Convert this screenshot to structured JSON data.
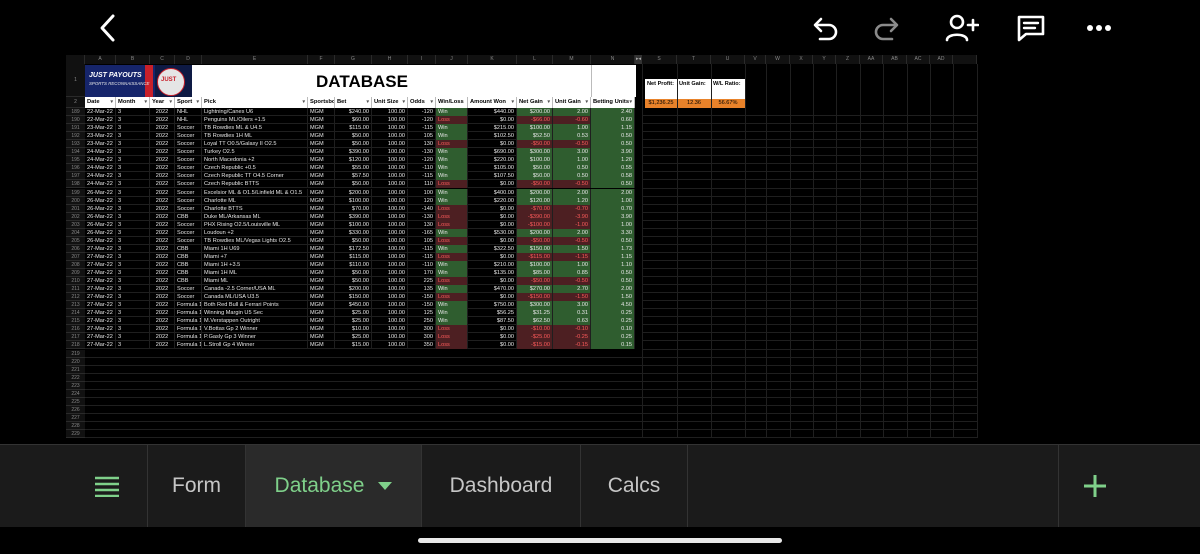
{
  "toolbar": {
    "icons": [
      "back-icon",
      "undo-icon",
      "redo-icon",
      "share-person-icon",
      "comment-icon",
      "more-icon"
    ]
  },
  "sheet": {
    "columns": [
      "A",
      "B",
      "C",
      "D",
      "E",
      "F",
      "G",
      "H",
      "I",
      "J",
      "K",
      "L",
      "M",
      "N",
      "S",
      "T",
      "U",
      "V",
      "W",
      "X",
      "Y",
      "Z",
      "AA",
      "AB",
      "AC",
      "AD"
    ],
    "title": "DATABASE",
    "logo_text_1": "JUST PAYOUTS",
    "logo_text_2": "SPORTS RECONNAISSANCE",
    "logo_badge": "JUST",
    "headers": [
      "Date",
      "Month",
      "Year",
      "Sport",
      "Pick",
      "Sportsbook",
      "Bet",
      "Unit Size",
      "Odds",
      "Win/Loss",
      "Amount Won",
      "Net Gain",
      "Unit Gain",
      "Betting Units"
    ],
    "summary": {
      "net_profit_label": "Net Profit:",
      "unit_gain_label": "Unit Gain:",
      "wl_ratio_label": "W/L Ratio:",
      "net_profit": "$1,236.25",
      "unit_gain": "12.36",
      "wl_ratio": "56.67%"
    },
    "row_numbers": [
      "1",
      "2",
      "189",
      "190",
      "191",
      "192",
      "193",
      "194",
      "195",
      "196",
      "197",
      "198",
      "199",
      "200",
      "201",
      "202",
      "203",
      "204",
      "205",
      "206",
      "207",
      "208",
      "209",
      "210",
      "211",
      "212",
      "213",
      "214",
      "215",
      "216",
      "217",
      "218",
      "219",
      "220",
      "221",
      "222",
      "223",
      "224",
      "225",
      "226",
      "227",
      "228",
      "229"
    ],
    "rows": [
      [
        "22-Mar-22",
        "3",
        "2022",
        "NHL",
        "Lightning/Canes U6",
        "MGM",
        "$240.00",
        "100.00",
        "-120",
        "Win",
        "$440.00",
        "$200.00",
        "2.00",
        "2.40"
      ],
      [
        "22-Mar-22",
        "3",
        "2022",
        "NHL",
        "Penguins ML/Oilers +1.5",
        "MGM",
        "$60.00",
        "100.00",
        "-120",
        "Loss",
        "$0.00",
        "-$66.00",
        "-0.60",
        "0.60"
      ],
      [
        "23-Mar-22",
        "3",
        "2022",
        "Soccer",
        "TB Rowdies ML & U4.5",
        "MGM",
        "$115.00",
        "100.00",
        "-115",
        "Win",
        "$215.00",
        "$100.00",
        "1.00",
        "1.15"
      ],
      [
        "23-Mar-22",
        "3",
        "2022",
        "Soccer",
        "TB Rowdies 1H ML",
        "MGM",
        "$50.00",
        "100.00",
        "105",
        "Win",
        "$102.50",
        "$52.50",
        "0.53",
        "0.50"
      ],
      [
        "23-Mar-22",
        "3",
        "2022",
        "Soccer",
        "Loyal TT O0.5/Galaxy II O2.5",
        "MGM",
        "$50.00",
        "100.00",
        "130",
        "Loss",
        "$0.00",
        "-$50.00",
        "-0.50",
        "0.50"
      ],
      [
        "24-Mar-22",
        "3",
        "2022",
        "Soccer",
        "Turkey O2.5",
        "MGM",
        "$390.00",
        "100.00",
        "-130",
        "Win",
        "$690.00",
        "$300.00",
        "3.00",
        "3.90"
      ],
      [
        "24-Mar-22",
        "3",
        "2022",
        "Soccer",
        "North Macedonia +2",
        "MGM",
        "$120.00",
        "100.00",
        "-120",
        "Win",
        "$220.00",
        "$100.00",
        "1.00",
        "1.20"
      ],
      [
        "24-Mar-22",
        "3",
        "2022",
        "Soccer",
        "Czech Republic +0.5",
        "MGM",
        "$55.00",
        "100.00",
        "-110",
        "Win",
        "$105.00",
        "$50.00",
        "0.50",
        "0.55"
      ],
      [
        "24-Mar-22",
        "3",
        "2022",
        "Soccer",
        "Czech Republic TT O4.5 Corner",
        "MGM",
        "$57.50",
        "100.00",
        "-115",
        "Win",
        "$107.50",
        "$50.00",
        "0.50",
        "0.58"
      ],
      [
        "24-Mar-22",
        "3",
        "2022",
        "Soccer",
        "Czech Republic BTTS",
        "MGM",
        "$50.00",
        "100.00",
        "110",
        "Loss",
        "$0.00",
        "-$50.00",
        "-0.50",
        "0.50"
      ],
      [
        "26-Mar-22",
        "3",
        "2022",
        "Soccer",
        "Excelsior ML & O1.5/Linfield ML & O1.5",
        "MGM",
        "$200.00",
        "100.00",
        "100",
        "Win",
        "$400.00",
        "$200.00",
        "2.00",
        "2.00"
      ],
      [
        "26-Mar-22",
        "3",
        "2022",
        "Soccer",
        "Charlotte ML",
        "MGM",
        "$100.00",
        "100.00",
        "120",
        "Win",
        "$220.00",
        "$120.00",
        "1.20",
        "1.00"
      ],
      [
        "26-Mar-22",
        "3",
        "2022",
        "Soccer",
        "Charlotte BTTS",
        "MGM",
        "$70.00",
        "100.00",
        "-140",
        "Loss",
        "$0.00",
        "-$70.00",
        "-0.70",
        "0.70"
      ],
      [
        "26-Mar-22",
        "3",
        "2022",
        "CBB",
        "Duke ML/Arkansas ML",
        "MGM",
        "$390.00",
        "100.00",
        "-130",
        "Loss",
        "$0.00",
        "-$390.00",
        "-3.90",
        "3.90"
      ],
      [
        "26-Mar-22",
        "3",
        "2022",
        "Soccer",
        "PHX Rising O2.5/Louisville ML",
        "MGM",
        "$100.00",
        "100.00",
        "130",
        "Loss",
        "$0.00",
        "-$100.00",
        "-1.00",
        "1.00"
      ],
      [
        "26-Mar-22",
        "3",
        "2022",
        "Soccer",
        "Loudoun +2",
        "MGM",
        "$330.00",
        "100.00",
        "-165",
        "Win",
        "$530.00",
        "$200.00",
        "2.00",
        "3.30"
      ],
      [
        "26-Mar-22",
        "3",
        "2022",
        "Soccer",
        "TB Rowdies ML/Vegas Lights O2.5",
        "MGM",
        "$50.00",
        "100.00",
        "105",
        "Loss",
        "$0.00",
        "-$50.00",
        "-0.50",
        "0.50"
      ],
      [
        "27-Mar-22",
        "3",
        "2022",
        "CBB",
        "Miami 1H U69",
        "MGM",
        "$172.50",
        "100.00",
        "-115",
        "Win",
        "$322.50",
        "$150.00",
        "1.50",
        "1.73"
      ],
      [
        "27-Mar-22",
        "3",
        "2022",
        "CBB",
        "Miami +7",
        "MGM",
        "$115.00",
        "100.00",
        "-115",
        "Loss",
        "$0.00",
        "-$115.00",
        "-1.15",
        "1.15"
      ],
      [
        "27-Mar-22",
        "3",
        "2022",
        "CBB",
        "Miami 1H +3.5",
        "MGM",
        "$110.00",
        "100.00",
        "-110",
        "Win",
        "$210.00",
        "$100.00",
        "1.00",
        "1.10"
      ],
      [
        "27-Mar-22",
        "3",
        "2022",
        "CBB",
        "Miami 1H ML",
        "MGM",
        "$50.00",
        "100.00",
        "170",
        "Win",
        "$135.00",
        "$85.00",
        "0.85",
        "0.50"
      ],
      [
        "27-Mar-22",
        "3",
        "2022",
        "CBB",
        "Miami ML",
        "MGM",
        "$50.00",
        "100.00",
        "225",
        "Loss",
        "$0.00",
        "-$50.00",
        "-0.50",
        "0.50"
      ],
      [
        "27-Mar-22",
        "3",
        "2022",
        "Soccer",
        "Canada -2.5 Corner/USA ML",
        "MGM",
        "$200.00",
        "100.00",
        "135",
        "Win",
        "$470.00",
        "$270.00",
        "2.70",
        "2.00"
      ],
      [
        "27-Mar-22",
        "3",
        "2022",
        "Soccer",
        "Canada ML/USA U3.5",
        "MGM",
        "$150.00",
        "100.00",
        "-150",
        "Loss",
        "$0.00",
        "-$150.00",
        "-1.50",
        "1.50"
      ],
      [
        "27-Mar-22",
        "3",
        "2022",
        "Formula 1",
        "Both Red Bull & Ferrari Points",
        "MGM",
        "$450.00",
        "100.00",
        "-150",
        "Win",
        "$750.00",
        "$300.00",
        "3.00",
        "4.50"
      ],
      [
        "27-Mar-22",
        "3",
        "2022",
        "Formula 1",
        "Winning Margin U5 Sec",
        "MGM",
        "$25.00",
        "100.00",
        "125",
        "Win",
        "$56.25",
        "$31.25",
        "0.31",
        "0.25"
      ],
      [
        "27-Mar-22",
        "3",
        "2022",
        "Formula 1",
        "M.Verstappen Outright",
        "MGM",
        "$25.00",
        "100.00",
        "250",
        "Win",
        "$87.50",
        "$62.50",
        "0.63",
        "0.25"
      ],
      [
        "27-Mar-22",
        "3",
        "2022",
        "Formula 1",
        "V.Bottas Gp 2 Winner",
        "MGM",
        "$10.00",
        "100.00",
        "300",
        "Loss",
        "$0.00",
        "-$10.00",
        "-0.10",
        "0.10"
      ],
      [
        "27-Mar-22",
        "3",
        "2022",
        "Formula 1",
        "P.Gasly Gp 3 Winner",
        "MGM",
        "$25.00",
        "100.00",
        "300",
        "Loss",
        "$0.00",
        "-$25.00",
        "-0.25",
        "0.25"
      ],
      [
        "27-Mar-22",
        "3",
        "2022",
        "Formula 1",
        "L.Stroll Gp 4 Winner",
        "MGM",
        "$15.00",
        "100.00",
        "350",
        "Loss",
        "$0.00",
        "-$15.00",
        "-0.15",
        "0.15"
      ]
    ]
  },
  "tabs": {
    "menu_icon": "all-sheets-icon",
    "items": [
      "Form",
      "Database",
      "Dashboard",
      "Calcs"
    ],
    "active": "Database",
    "add_icon": "add-sheet-icon"
  },
  "colors": {
    "win_bg": "#2f5d2f",
    "loss_bg": "#4d1f22",
    "loss_text": "#ff5b5b",
    "accent_green": "#7fd08a",
    "orange": "#e8822a"
  }
}
